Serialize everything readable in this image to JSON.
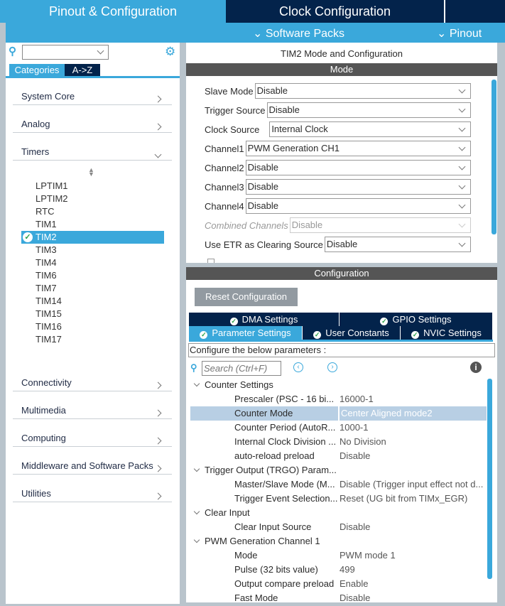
{
  "header": {
    "tabs": [
      "Pinout & Configuration",
      "Clock Configuration"
    ],
    "sub": [
      "Software Packs",
      "Pinout"
    ]
  },
  "left": {
    "tabs": [
      "Categories",
      "A->Z"
    ],
    "categories_top": [
      "System Core",
      "Analog",
      "Timers"
    ],
    "timers": [
      "LPTIM1",
      "LPTIM2",
      "RTC",
      "TIM1",
      "TIM2",
      "TIM3",
      "TIM4",
      "TIM6",
      "TIM7",
      "TIM14",
      "TIM15",
      "TIM16",
      "TIM17"
    ],
    "selected_timer": "TIM2",
    "categories_bottom": [
      "Connectivity",
      "Multimedia",
      "Computing",
      "Middleware and Software Packs",
      "Utilities"
    ]
  },
  "mode": {
    "title": "TIM2 Mode and Configuration",
    "bar": "Mode",
    "rows": [
      {
        "label": "Slave Mode",
        "value": "Disable"
      },
      {
        "label": "Trigger Source",
        "value": "Disable"
      },
      {
        "label": "Clock Source",
        "value": "Internal Clock"
      },
      {
        "label": "Channel1",
        "value": "PWM Generation CH1"
      },
      {
        "label": "Channel2",
        "value": "Disable"
      },
      {
        "label": "Channel3",
        "value": "Disable"
      },
      {
        "label": "Channel4",
        "value": "Disable"
      },
      {
        "label": "Combined Channels",
        "value": "Disable"
      },
      {
        "label": "Use ETR as Clearing Source",
        "value": "Disable"
      }
    ]
  },
  "config": {
    "bar": "Configuration",
    "reset": "Reset Configuration",
    "tabs_row1": [
      "DMA Settings",
      "GPIO Settings"
    ],
    "tabs_row2": [
      "Parameter Settings",
      "User Constants",
      "NVIC Settings"
    ],
    "hint": "Configure the below parameters :",
    "search_placeholder": "Search (Ctrl+F)",
    "tree": [
      {
        "group": "Counter Settings"
      },
      {
        "k": "Prescaler (PSC - 16 bi...",
        "v": "16000-1"
      },
      {
        "k": "Counter Mode",
        "v": "Center Aligned mode2",
        "selected": true
      },
      {
        "k": "Counter Period (AutoR...",
        "v": "1000-1"
      },
      {
        "k": "Internal Clock Division ...",
        "v": "No Division"
      },
      {
        "k": "auto-reload preload",
        "v": "Disable"
      },
      {
        "group": "Trigger Output (TRGO) Param..."
      },
      {
        "k": "Master/Slave Mode (M...",
        "v": "Disable (Trigger input effect not d..."
      },
      {
        "k": "Trigger Event Selection...",
        "v": "Reset (UG bit from TIMx_EGR)"
      },
      {
        "group": "Clear Input"
      },
      {
        "k": "Clear Input Source",
        "v": "Disable"
      },
      {
        "group": "PWM Generation Channel 1"
      },
      {
        "k": "Mode",
        "v": "PWM mode 1"
      },
      {
        "k": "Pulse (32 bits value)",
        "v": "499"
      },
      {
        "k": "Output compare preload",
        "v": "Enable"
      },
      {
        "k": "Fast Mode",
        "v": "Disable"
      }
    ]
  }
}
